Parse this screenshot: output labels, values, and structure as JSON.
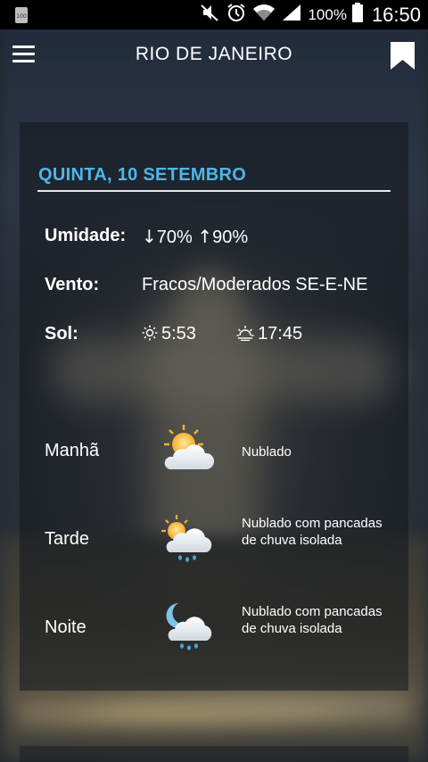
{
  "status_bar": {
    "battery_percent_text": "100%",
    "time": "16:50",
    "left_badge": "100"
  },
  "app_bar": {
    "title": "RIO DE JANEIRO"
  },
  "forecast": {
    "date_header": "QUINTA, 10 SETEMBRO",
    "humidity": {
      "label": "Umidade:",
      "min": "70%",
      "max": "90%"
    },
    "wind": {
      "label": "Vento:",
      "value": "Fracos/Moderados SE-E-NE"
    },
    "sun": {
      "label": "Sol:",
      "sunrise": "5:53",
      "sunset": "17:45"
    },
    "periods": [
      {
        "name": "Manhã",
        "icon": "partly-cloudy-sun-icon",
        "description": "Nublado"
      },
      {
        "name": "Tarde",
        "icon": "sun-cloud-rain-icon",
        "description": "Nublado com pancadas de chuva isolada"
      },
      {
        "name": "Noite",
        "icon": "moon-cloud-rain-icon",
        "description": "Nublado com pancadas de chuva isolada"
      }
    ]
  },
  "colors": {
    "accent": "#4fb6e8",
    "status_bar": "#000000",
    "card_bg": "rgba(20,24,30,0.55)"
  }
}
